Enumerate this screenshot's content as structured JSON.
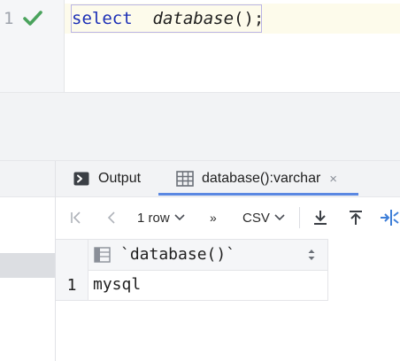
{
  "editor": {
    "line_number": "1",
    "code": {
      "keyword": "select",
      "spacer": "  ",
      "function_name": "database",
      "punct": "();"
    }
  },
  "results": {
    "tabs": {
      "output_label": "Output",
      "result_label": "database():varchar",
      "close_glyph": "×"
    },
    "toolbar": {
      "first_glyph": "|<",
      "prev_glyph": "<",
      "rows_label": "1 row",
      "next_glyph": "»",
      "format_label": "CSV"
    },
    "grid": {
      "column_header": "`database()`",
      "rows": [
        {
          "num": "1",
          "value": "mysql"
        }
      ]
    }
  },
  "colors": {
    "keyword": "#1c2fb6",
    "check": "#4aa35d",
    "tab_underline": "#5b88e2",
    "accent_blue": "#3d7ed8"
  }
}
